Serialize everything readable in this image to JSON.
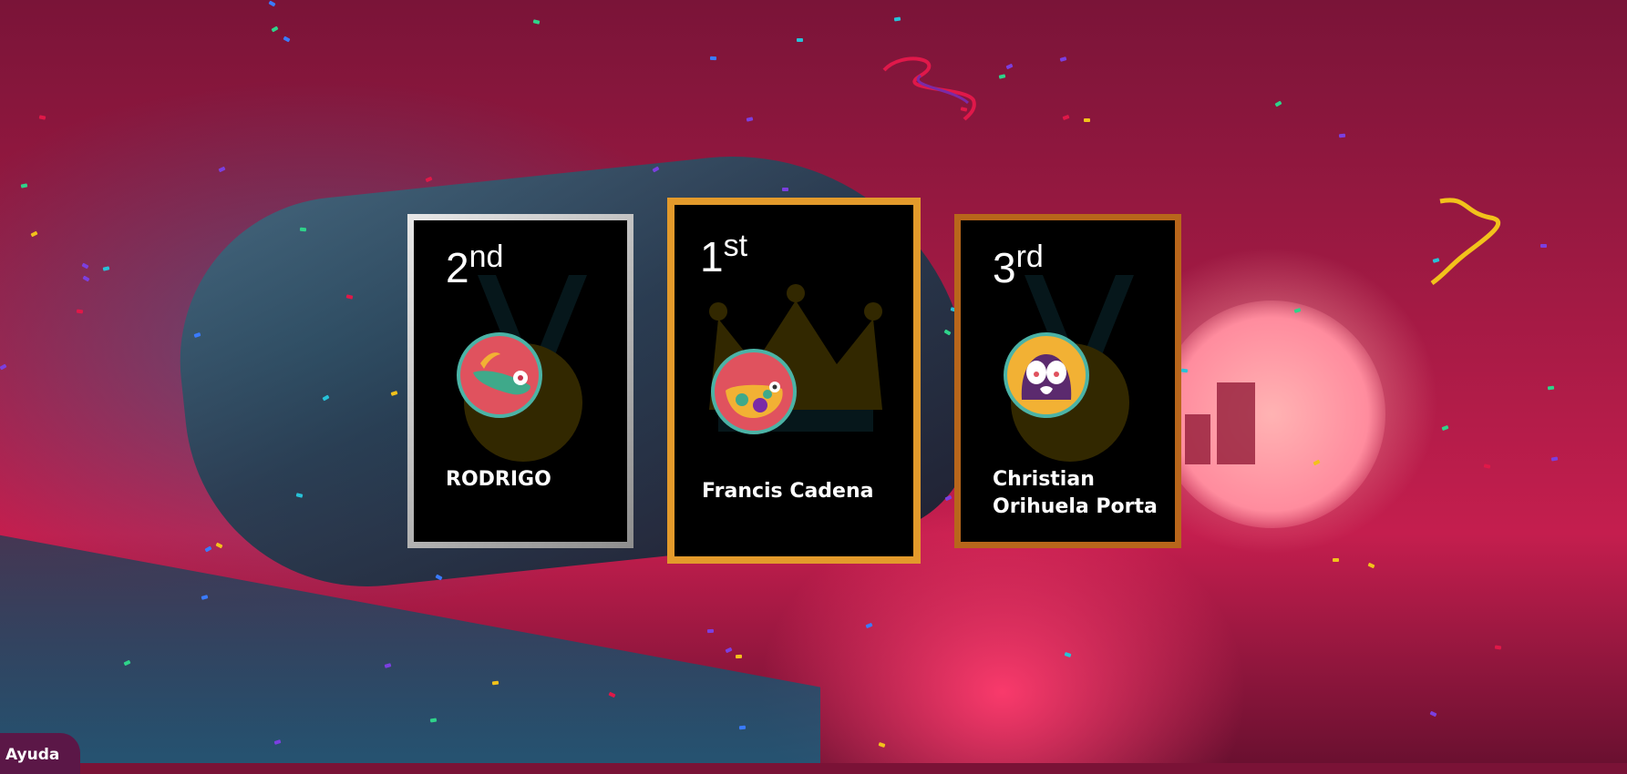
{
  "podium": {
    "first": {
      "rank_number": "1",
      "rank_suffix": "st",
      "name": "Francis Cadena",
      "frame_color": "#e39a2b",
      "avatar_icon": "bird-icon"
    },
    "second": {
      "rank_number": "2",
      "rank_suffix": "nd",
      "name": "RODRIGO",
      "frame_color": "#c9c9c9",
      "avatar_icon": "hat-icon"
    },
    "third": {
      "rank_number": "3",
      "rank_suffix": "rd",
      "name_line1": "Christian",
      "name_line2": "Orihuela Porta",
      "frame_color": "#b8661b",
      "avatar_icon": "creature-icon"
    }
  },
  "help": {
    "label": "Ayuda"
  },
  "colors": {
    "avatar_ring": "#4bb3a6",
    "avatar_fill": "#e0525e",
    "card_bg": "#000000"
  }
}
